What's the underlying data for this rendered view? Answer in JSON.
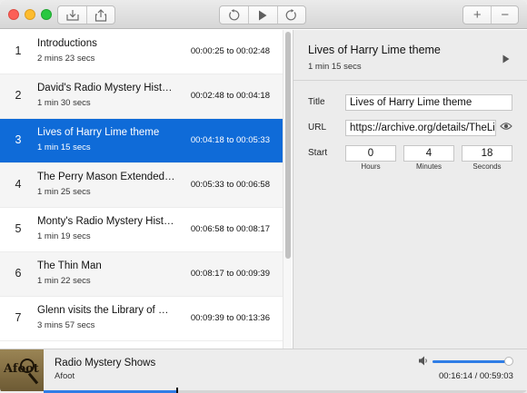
{
  "toolbar": {
    "import_icon": "tray-download-icon",
    "share_icon": "share-icon",
    "rewind_icon": "rewind-icon",
    "play_icon": "play-icon",
    "forward_icon": "forward-icon",
    "add_label": "+",
    "remove_label": "−"
  },
  "chapters": [
    {
      "num": "1",
      "title": "Introductions",
      "duration": "2 mins 23 secs",
      "range": "00:00:25 to 00:02:48"
    },
    {
      "num": "2",
      "title": "David's Radio Mystery History",
      "duration": "1 min 30 secs",
      "range": "00:02:48 to 00:04:18"
    },
    {
      "num": "3",
      "title": "Lives of Harry Lime theme",
      "duration": "1 min 15 secs",
      "range": "00:04:18 to 00:05:33"
    },
    {
      "num": "4",
      "title": "The Perry Mason Extended Universe",
      "duration": "1 min 25 secs",
      "range": "00:05:33 to 00:06:58"
    },
    {
      "num": "5",
      "title": "Monty's Radio Mystery History",
      "duration": "1 min 19 secs",
      "range": "00:06:58 to 00:08:17"
    },
    {
      "num": "6",
      "title": "The Thin Man",
      "duration": "1 min 22 secs",
      "range": "00:08:17 to 00:09:39"
    },
    {
      "num": "7",
      "title": "Glenn visits the Library of Congress",
      "duration": "3 mins 57 secs",
      "range": "00:09:39 to 00:13:36"
    }
  ],
  "selected_index": 2,
  "detail": {
    "title": "Lives of Harry Lime theme",
    "duration": "1 min 15 secs",
    "title_label": "Title",
    "title_value": "Lives of Harry Lime theme",
    "url_label": "URL",
    "url_value": "https://archive.org/details/TheLivesOfHarryLime",
    "start_label": "Start",
    "hours": "0",
    "minutes": "4",
    "seconds": "18",
    "hours_label": "Hours",
    "minutes_label": "Minutes",
    "seconds_label": "Seconds"
  },
  "player": {
    "title": "Radio Mystery Shows",
    "subtitle": "Afoot",
    "artwork_text": "Afoot",
    "time": "00:16:14 / 00:59:03",
    "volume": 0.95,
    "progress": 0.275
  },
  "colors": {
    "selection": "#0f6bd8",
    "accent": "#2f7de6"
  }
}
